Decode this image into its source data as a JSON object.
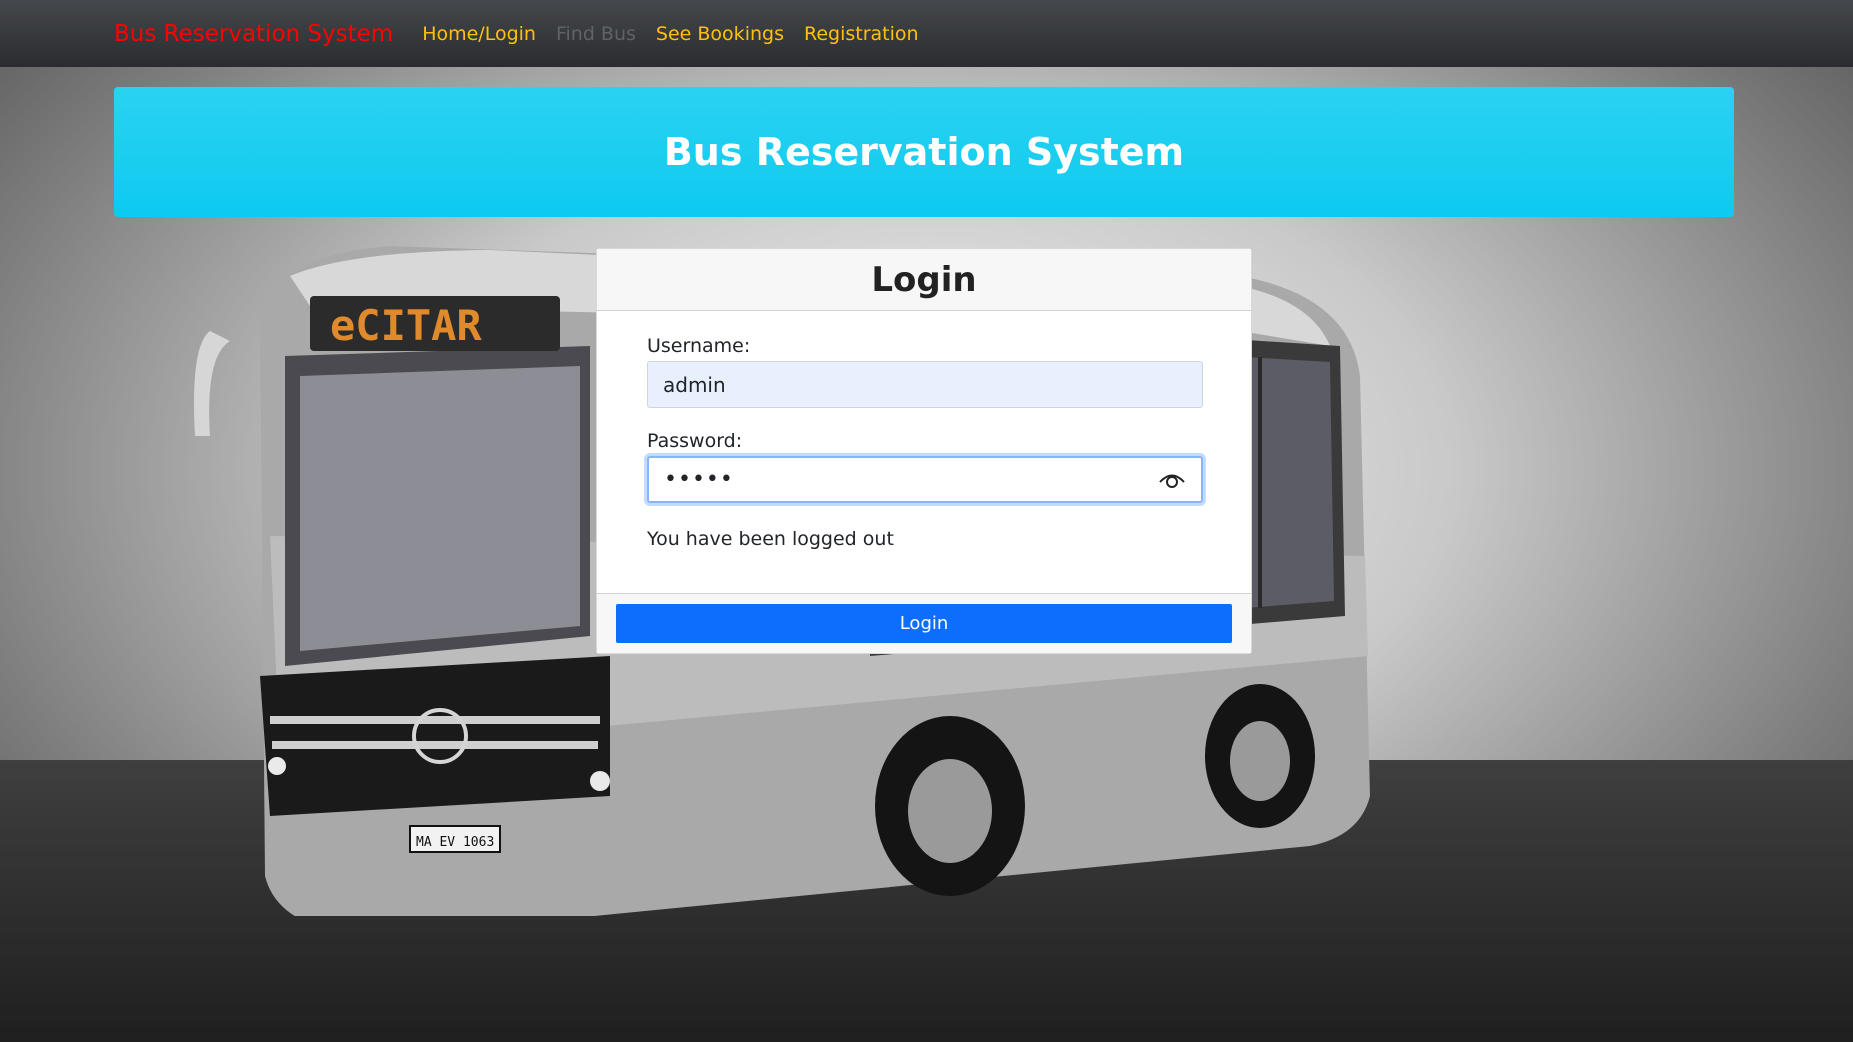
{
  "navbar": {
    "brand": "Bus Reservation System",
    "links": [
      {
        "label": "Home/Login",
        "state": "active"
      },
      {
        "label": "Find Bus",
        "state": "disabled"
      },
      {
        "label": "See Bookings",
        "state": "active"
      },
      {
        "label": "Registration",
        "state": "active"
      }
    ]
  },
  "hero": {
    "title": "Bus Reservation System"
  },
  "bus_sign": "eCITAR",
  "bus_plate": "MA EV 1063",
  "login": {
    "title": "Login",
    "username_label": "Username:",
    "username_value": "admin",
    "password_label": "Password:",
    "password_masked": "•••••",
    "status_message": "You have been logged out",
    "submit_label": "Login"
  },
  "colors": {
    "brand": "#ff0000",
    "nav_link": "#ffc107",
    "nav_disabled": "#5f6266",
    "hero_bg": "#0dcaf0",
    "primary_button": "#0d6efd",
    "username_autofill_bg": "#e8f0fe"
  },
  "icons": {
    "password_toggle": "eye-icon"
  }
}
